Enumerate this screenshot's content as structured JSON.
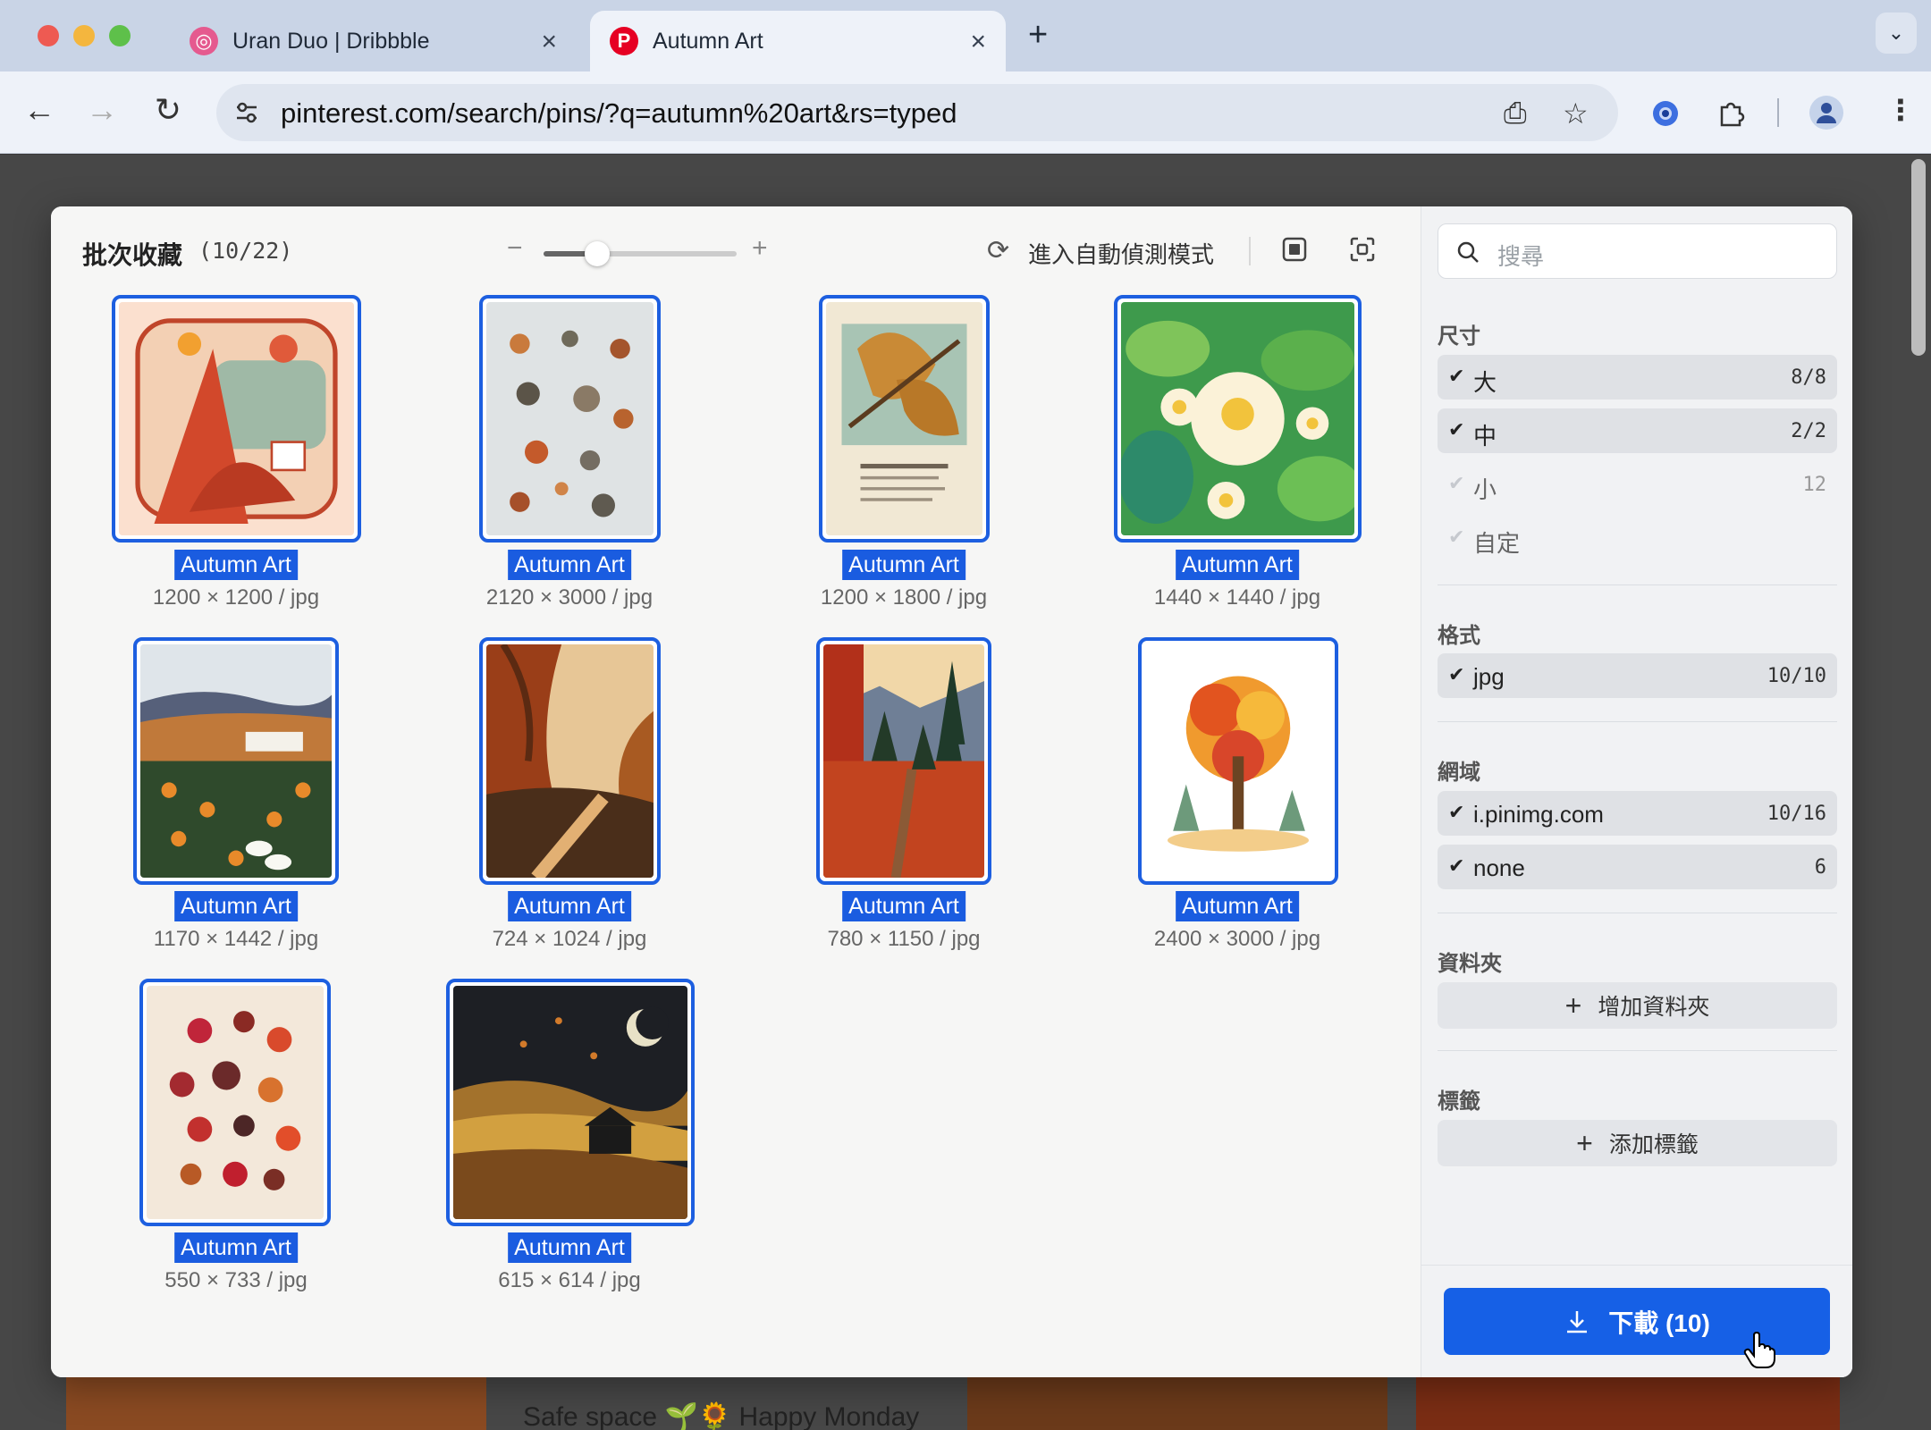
{
  "browser": {
    "tabs": [
      {
        "title": "Uran Duo | Dribbble",
        "active": false
      },
      {
        "title": "Autumn Art",
        "active": true
      }
    ],
    "new_tab": "+",
    "url": "pinterest.com/search/pins/?q=autumn%20art&rs=typed"
  },
  "background_page": {
    "caption": "Safe space 🌱🌻 Happy Monday"
  },
  "modal": {
    "title": "批次收藏",
    "count": "(10/22)",
    "zoom_minus": "−",
    "zoom_plus": "+",
    "zoom_level": 0.28,
    "auto_detect_label": "進入自動偵測模式",
    "images": [
      {
        "caption": "Autumn Art",
        "meta": "1200 × 1200 / jpg"
      },
      {
        "caption": "Autumn Art",
        "meta": "2120 × 3000 / jpg"
      },
      {
        "caption": "Autumn Art",
        "meta": "1200 × 1800 / jpg"
      },
      {
        "caption": "Autumn Art",
        "meta": "1440 × 1440 / jpg"
      },
      {
        "caption": "Autumn Art",
        "meta": "1170 × 1442 / jpg"
      },
      {
        "caption": "Autumn Art",
        "meta": "724 × 1024 / jpg"
      },
      {
        "caption": "Autumn Art",
        "meta": "780 × 1150 / jpg"
      },
      {
        "caption": "Autumn Art",
        "meta": "2400 × 3000 / jpg"
      },
      {
        "caption": "Autumn Art",
        "meta": "550 × 733 / jpg"
      },
      {
        "caption": "Autumn Art",
        "meta": "615 × 614 / jpg"
      }
    ]
  },
  "sidebar": {
    "search_placeholder": "搜尋",
    "size": {
      "heading": "尺寸",
      "options": [
        {
          "label": "大",
          "count": "8/8",
          "checked": true
        },
        {
          "label": "中",
          "count": "2/2",
          "checked": true
        },
        {
          "label": "小",
          "count": "12",
          "checked": false
        },
        {
          "label": "自定",
          "count": "",
          "checked": false
        }
      ]
    },
    "format": {
      "heading": "格式",
      "options": [
        {
          "label": "jpg",
          "count": "10/10",
          "checked": true
        }
      ]
    },
    "domain": {
      "heading": "網域",
      "options": [
        {
          "label": "i.pinimg.com",
          "count": "10/16",
          "checked": true
        },
        {
          "label": "none",
          "count": "6",
          "checked": true
        }
      ]
    },
    "folder": {
      "heading": "資料夾",
      "add_label": "增加資料夾"
    },
    "tags": {
      "heading": "標籤",
      "add_label": "添加標籤"
    },
    "download_label": "下載 (10)"
  },
  "colors": {
    "accent": "#1660e6",
    "selection_border": "#1d5fe0",
    "caption_bg": "#1a5ce0"
  }
}
